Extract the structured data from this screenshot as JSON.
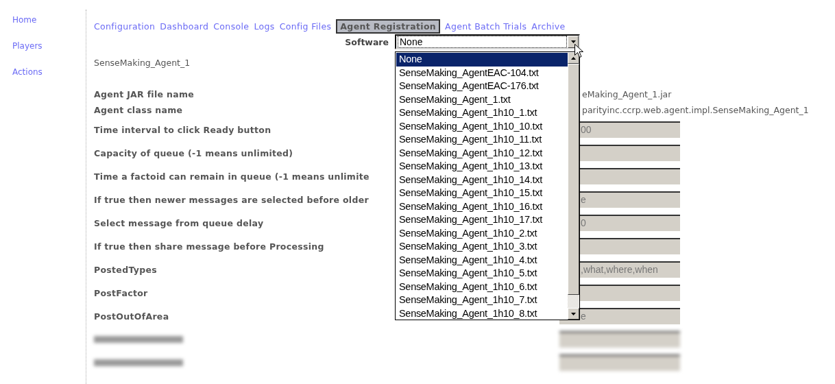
{
  "sidebar": {
    "items": [
      {
        "label": "Home"
      },
      {
        "label": "Players"
      },
      {
        "label": "Actions"
      }
    ]
  },
  "tabs": [
    {
      "label": "Configuration",
      "selected": false
    },
    {
      "label": "Dashboard",
      "selected": false
    },
    {
      "label": "Console",
      "selected": false
    },
    {
      "label": "Logs",
      "selected": false
    },
    {
      "label": "Config Files",
      "selected": false
    },
    {
      "label": "Agent Registration",
      "selected": true
    },
    {
      "label": "Agent Batch Trials",
      "selected": false
    },
    {
      "label": "Archive",
      "selected": false
    }
  ],
  "software": {
    "label": "Software",
    "value": "None",
    "expanded": true,
    "options": [
      {
        "label": "None",
        "selected": true
      },
      {
        "label": "SenseMaking_AgentEAC-104.txt",
        "selected": false
      },
      {
        "label": "SenseMaking_AgentEAC-176.txt",
        "selected": false
      },
      {
        "label": "SenseMaking_Agent_1.txt",
        "selected": false
      },
      {
        "label": "SenseMaking_Agent_1h10_1.txt",
        "selected": false
      },
      {
        "label": "SenseMaking_Agent_1h10_10.txt",
        "selected": false
      },
      {
        "label": "SenseMaking_Agent_1h10_11.txt",
        "selected": false
      },
      {
        "label": "SenseMaking_Agent_1h10_12.txt",
        "selected": false
      },
      {
        "label": "SenseMaking_Agent_1h10_13.txt",
        "selected": false
      },
      {
        "label": "SenseMaking_Agent_1h10_14.txt",
        "selected": false
      },
      {
        "label": "SenseMaking_Agent_1h10_15.txt",
        "selected": false
      },
      {
        "label": "SenseMaking_Agent_1h10_16.txt",
        "selected": false
      },
      {
        "label": "SenseMaking_Agent_1h10_17.txt",
        "selected": false
      },
      {
        "label": "SenseMaking_Agent_1h10_2.txt",
        "selected": false
      },
      {
        "label": "SenseMaking_Agent_1h10_3.txt",
        "selected": false
      },
      {
        "label": "SenseMaking_Agent_1h10_4.txt",
        "selected": false
      },
      {
        "label": "SenseMaking_Agent_1h10_5.txt",
        "selected": false
      },
      {
        "label": "SenseMaking_Agent_1h10_6.txt",
        "selected": false
      },
      {
        "label": "SenseMaking_Agent_1h10_7.txt",
        "selected": false
      },
      {
        "label": "SenseMaking_Agent_1h10_8.txt",
        "selected": false
      }
    ]
  },
  "agent_name": "SenseMaking_Agent_1",
  "fields": [
    {
      "kind": "text",
      "label": "Agent JAR file name",
      "value": "eMaking_Agent_1.jar"
    },
    {
      "kind": "text",
      "label": "Agent class name",
      "value": "parityinc.ccrp.web.agent.impl.SenseMaking_Agent_1"
    },
    {
      "kind": "input",
      "label": "Time interval to click Ready button",
      "value": "00"
    },
    {
      "kind": "input",
      "label": "Capacity of queue (-1 means unlimited)"
    },
    {
      "kind": "input",
      "label": "Time a factoid can remain in queue (-1 means unlimite"
    },
    {
      "kind": "input",
      "label": "If true then newer messages are selected before older",
      "value": "e"
    },
    {
      "kind": "input",
      "label": "Select message from queue delay",
      "value": "0"
    },
    {
      "kind": "input",
      "label": "If true then share message before Processing"
    },
    {
      "kind": "input",
      "label": "PostedTypes",
      "value": ",what,where,when"
    },
    {
      "kind": "input",
      "label": "PostFactor"
    },
    {
      "kind": "input",
      "label": "PostOutOfArea",
      "value": "e"
    },
    {
      "kind": "redacted"
    },
    {
      "kind": "redacted"
    }
  ]
}
